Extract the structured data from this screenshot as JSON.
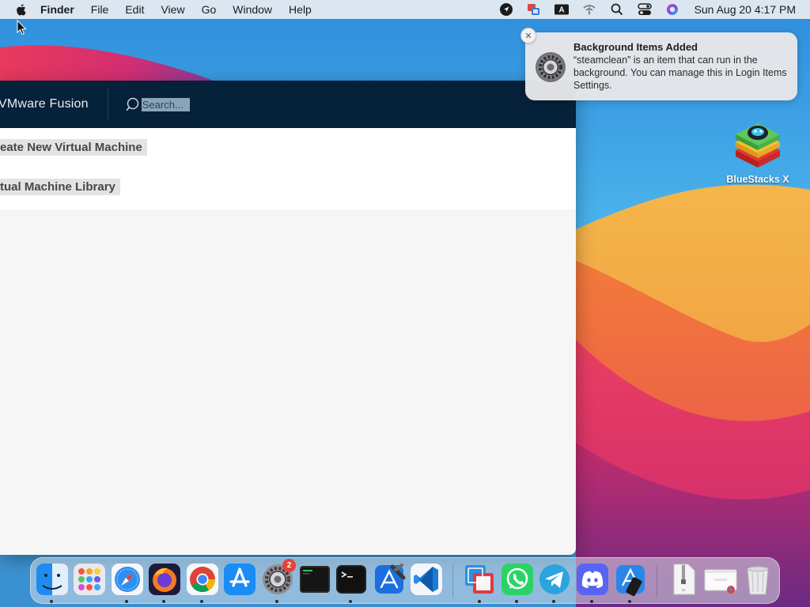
{
  "menubar": {
    "app_name": "Finder",
    "items": [
      "File",
      "Edit",
      "View",
      "Go",
      "Window",
      "Help"
    ],
    "status_icons": [
      "location-icon",
      "screen-sharing-icon",
      "input-source-icon",
      "wifi-icon",
      "spotlight-icon",
      "control-center-icon",
      "siri-icon"
    ],
    "input_source_letter": "A",
    "clock": "Sun Aug 20  4:17 PM"
  },
  "vmware": {
    "title": "VMware Fusion",
    "search_placeholder": "Search...",
    "links": [
      "eate New Virtual Machine",
      "tual Machine Library"
    ],
    "header_color": "#06213a"
  },
  "notification": {
    "title": "Background Items Added",
    "body": "“steamclean” is an item that can run in the background. You can manage this in Login Items Settings.",
    "close_glyph": "✕",
    "icon": "system-settings-icon"
  },
  "desktop": {
    "items": [
      {
        "label": "BlueStacks X",
        "icon": "bluestacks-icon"
      }
    ]
  },
  "dock": {
    "apps": [
      {
        "name": "finder-icon",
        "running": true
      },
      {
        "name": "launchpad-icon",
        "running": false
      },
      {
        "name": "safari-icon",
        "running": true
      },
      {
        "name": "firefox-icon",
        "running": true
      },
      {
        "name": "chrome-icon",
        "running": true
      },
      {
        "name": "app-store-icon",
        "running": false
      },
      {
        "name": "system-settings-icon",
        "running": true,
        "badge": "2"
      },
      {
        "name": "console-icon",
        "running": false
      },
      {
        "name": "terminal-icon",
        "running": true
      },
      {
        "name": "xcode-icon",
        "running": false
      },
      {
        "name": "vscode-icon",
        "running": false
      },
      {
        "name": "vmware-fusion-icon",
        "running": true
      },
      {
        "name": "whatsapp-icon",
        "running": true
      },
      {
        "name": "telegram-icon",
        "running": true
      },
      {
        "name": "discord-icon",
        "running": true
      },
      {
        "name": "simulator-icon",
        "running": true
      },
      {
        "name": "archive-utility-icon",
        "running": false
      },
      {
        "name": "google-chrome-window-icon",
        "running": false
      },
      {
        "name": "trash-icon",
        "running": false
      }
    ]
  }
}
